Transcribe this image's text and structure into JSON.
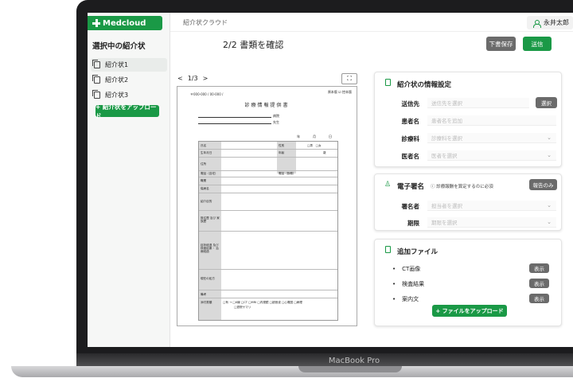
{
  "app": {
    "logo": "Medcloud",
    "breadcrumb": "紹介状クラウド",
    "user": "永井太郎"
  },
  "sidebar": {
    "heading": "選択中の紹介状",
    "items": [
      {
        "label": "紹介状1"
      },
      {
        "label": "紹介状2"
      },
      {
        "label": "紹介状3"
      }
    ],
    "upload_label": "+ 紹介状をアップロード"
  },
  "main": {
    "title": "2/2 書類を確認",
    "draft_label": "下書保存",
    "send_label": "送信"
  },
  "preview": {
    "prev": "<",
    "page": "1/3",
    "next": ">",
    "doc_title": "診療情報提供書",
    "doc_head_left": "〒000-000 / 00-000 /",
    "doc_head_right": "原本版  ☑ 控本版",
    "hospital": "病院",
    "doctor": "先生",
    "date_labels": "年　月　日",
    "row_labels": [
      "氏名",
      "生年月日",
      "住所",
      "電話（自宅）",
      "職業",
      "傷病名",
      "紹介目的",
      "既往歴 及び 家族歴",
      "症状経過 及び 検査結果・ 治療経過",
      "現在の処方",
      "備考",
      "添付書類"
    ],
    "cell_sex": "性別",
    "cell_sex_opts": "□男　□女",
    "cell_age": "年齢",
    "cell_age_unit": "歳",
    "cell_phone2": "電話（勤務）",
    "attach_opts": "□有 → □X線 □CT □MRI □内視鏡 □超音波 □心電図 □病理",
    "attach_opts2": "□退院サマリ"
  },
  "info": {
    "title": "紹介状の情報設定",
    "fields": [
      {
        "label": "送信先",
        "placeholder": "送信先を選択"
      },
      {
        "label": "患者名",
        "placeholder": "患者名を追加"
      },
      {
        "label": "診療科",
        "placeholder": "診療科を選択"
      },
      {
        "label": "医者名",
        "placeholder": "医者を選択"
      }
    ],
    "select_label": "選択"
  },
  "signature": {
    "title": "電子署名",
    "note": "診療報酬を算定するのに必須",
    "report_label": "報告のみ",
    "fields": [
      {
        "label": "署名者",
        "placeholder": "担当者を選択"
      },
      {
        "label": "期限",
        "placeholder": "期限を選択"
      }
    ]
  },
  "files": {
    "title": "追加ファイル",
    "items": [
      {
        "name": "CT画像"
      },
      {
        "name": "検査結果"
      },
      {
        "name": "案内文"
      }
    ],
    "view_label": "表示",
    "upload_label": "+ ファイルをアップロード"
  },
  "device": {
    "label": "MacBook Pro"
  },
  "colors": {
    "accent": "#1a9946",
    "button_gray": "#6b6b6b",
    "bezel": "#1c1c1e"
  }
}
